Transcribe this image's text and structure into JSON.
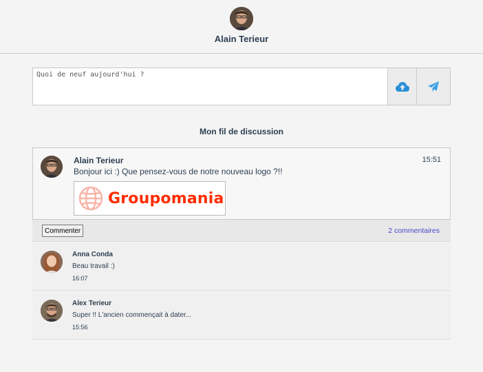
{
  "profile": {
    "name": "Alain Terieur"
  },
  "composer": {
    "placeholder": "Quoi de neuf aujourd'hui ?",
    "upload_icon": "cloud-upload-icon",
    "send_icon": "paper-plane-icon"
  },
  "feed": {
    "title": "Mon fil de discussion"
  },
  "post": {
    "author": "Alain Terieur",
    "time": "15:51",
    "text": "Bonjour ici :) Que pensez-vous de notre nouveau logo ?!!",
    "image_text": "Groupomania",
    "comment_button": "Commenter",
    "comments_count": "2 commentaires"
  },
  "comments": [
    {
      "author": "Anna Conda",
      "text": "Beau travail :)",
      "time": "16:07"
    },
    {
      "author": "Alex Terieur",
      "text": "Super !! L'ancien commençait à dater...",
      "time": "15:56"
    }
  ],
  "colors": {
    "brand_red": "#fd2d01",
    "icon_blue": "#2a8fd6",
    "link": "#4646c8"
  }
}
